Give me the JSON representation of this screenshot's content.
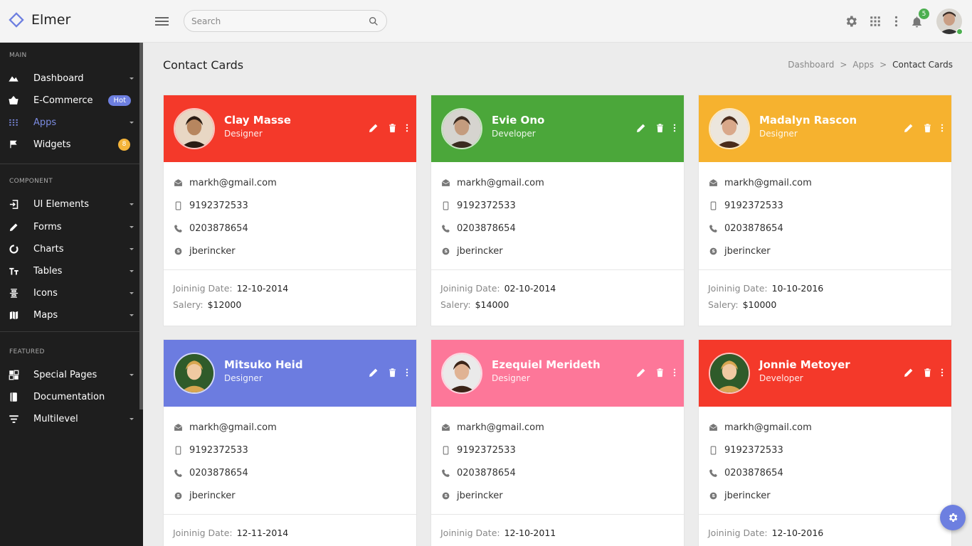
{
  "app": {
    "name": "Elmer"
  },
  "search": {
    "placeholder": "Search"
  },
  "header": {
    "notification_count": "5"
  },
  "sidebar": {
    "sections": [
      {
        "title": "MAIN",
        "items": [
          {
            "label": "Dashboard",
            "icon": "chart-icon",
            "caret": true
          },
          {
            "label": "E-Commerce",
            "icon": "basket-icon",
            "badge": "Hot"
          },
          {
            "label": "Apps",
            "icon": "apps-grid-icon",
            "caret": true,
            "active": true
          },
          {
            "label": "Widgets",
            "icon": "flag-icon",
            "count": "8"
          }
        ]
      },
      {
        "title": "COMPONENT",
        "items": [
          {
            "label": "UI Elements",
            "icon": "login-icon",
            "caret": true
          },
          {
            "label": "Forms",
            "icon": "pencil-icon",
            "caret": true
          },
          {
            "label": "Charts",
            "icon": "donut-chart-icon",
            "caret": true
          },
          {
            "label": "Tables",
            "icon": "text-height-icon",
            "caret": true
          },
          {
            "label": "Icons",
            "icon": "icons-icon",
            "caret": true
          },
          {
            "label": "Maps",
            "icon": "map-icon",
            "caret": true
          }
        ]
      },
      {
        "title": "FEATURED",
        "items": [
          {
            "label": "Special Pages",
            "icon": "pages-icon",
            "caret": true
          },
          {
            "label": "Documentation",
            "icon": "book-icon"
          },
          {
            "label": "Multilevel",
            "icon": "filter-icon",
            "caret": true
          }
        ]
      }
    ]
  },
  "page": {
    "title": "Contact Cards",
    "breadcrumb": [
      "Dashboard",
      "Apps",
      "Contact Cards"
    ]
  },
  "labels": {
    "joining": "Joininig Date:",
    "salary": "Salery:"
  },
  "colors": {
    "red": "#f4392a",
    "green": "#4ba73a",
    "amber": "#f6b22f",
    "indigo": "#6c7ce0",
    "pink": "#fd7799",
    "accent": "#6d7fe0"
  },
  "cards": [
    {
      "name": "Clay Masse",
      "role": "Designer",
      "color": "#f4392a",
      "email": "markh@gmail.com",
      "mobile": "9192372533",
      "phone": "0203878654",
      "skype": "jberincker",
      "joining": "12-10-2014",
      "salary": "$12000"
    },
    {
      "name": "Evie Ono",
      "role": "Developer",
      "color": "#4ba73a",
      "email": "markh@gmail.com",
      "mobile": "9192372533",
      "phone": "0203878654",
      "skype": "jberincker",
      "joining": "02-10-2014",
      "salary": "$14000"
    },
    {
      "name": "Madalyn Rascon",
      "role": "Designer",
      "color": "#f6b22f",
      "email": "markh@gmail.com",
      "mobile": "9192372533",
      "phone": "0203878654",
      "skype": "jberincker",
      "joining": "10-10-2016",
      "salary": "$10000"
    },
    {
      "name": "Mitsuko Heid",
      "role": "Designer",
      "color": "#6c7ce0",
      "email": "markh@gmail.com",
      "mobile": "9192372533",
      "phone": "0203878654",
      "skype": "jberincker",
      "joining": "12-11-2014",
      "salary": ""
    },
    {
      "name": "Ezequiel Merideth",
      "role": "Designer",
      "color": "#fd7799",
      "email": "markh@gmail.com",
      "mobile": "9192372533",
      "phone": "0203878654",
      "skype": "jberincker",
      "joining": "12-10-2011",
      "salary": ""
    },
    {
      "name": "Jonnie Metoyer",
      "role": "Developer",
      "color": "#f4392a",
      "email": "markh@gmail.com",
      "mobile": "9192372533",
      "phone": "0203878654",
      "skype": "jberincker",
      "joining": "12-10-2016",
      "salary": ""
    }
  ]
}
